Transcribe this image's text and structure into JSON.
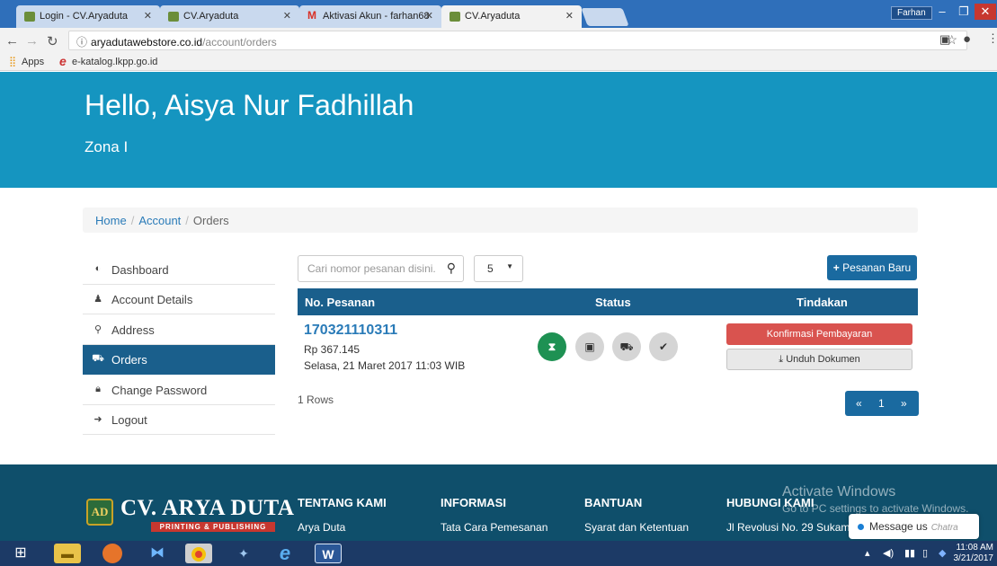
{
  "browser": {
    "tabs": [
      {
        "title": "Login - CV.Aryaduta",
        "favicon": "aryaduta-icon"
      },
      {
        "title": "CV.Aryaduta",
        "favicon": "aryaduta-icon"
      },
      {
        "title": "Aktivasi Akun - farhan68",
        "favicon": "gmail-icon"
      },
      {
        "title": "CV.Aryaduta",
        "favicon": "aryaduta-icon"
      }
    ],
    "user_label": "Farhan",
    "url_host": "aryadutawebstore.co.id",
    "url_path": "/account/orders",
    "bookmarks": [
      "Apps",
      "e-katalog.lkpp.go.id"
    ]
  },
  "hero": {
    "greeting": "Hello, Aisya Nur Fadhillah",
    "zone": "Zona I"
  },
  "breadcrumb": [
    "Home",
    "Account",
    "Orders"
  ],
  "sidebar": {
    "items": [
      {
        "label": "Dashboard",
        "icon": "dashboard-icon"
      },
      {
        "label": "Account Details",
        "icon": "user-icon"
      },
      {
        "label": "Address",
        "icon": "map-marker-icon"
      },
      {
        "label": "Orders",
        "icon": "cart-icon"
      },
      {
        "label": "Change Password",
        "icon": "lock-icon"
      },
      {
        "label": "Logout",
        "icon": "logout-icon"
      }
    ],
    "active": "Orders"
  },
  "orders": {
    "search_placeholder": "Cari nomor pesanan disini.",
    "per_page": "5",
    "new_button": "Pesanan Baru",
    "columns": [
      "No. Pesanan",
      "Status",
      "Tindakan"
    ],
    "rows": [
      {
        "order_no": "170321110311",
        "amount": "Rp 367.145",
        "date": "Selasa, 21 Maret 2017 11:03 WIB",
        "statuses": [
          "hourglass-icon",
          "money-icon",
          "truck-icon",
          "check-icon"
        ],
        "actions": [
          "Konfirmasi Pembayaran",
          "Unduh Dokumen"
        ]
      }
    ],
    "row_count": "1 Rows",
    "pagination": {
      "prev": "«",
      "page": "1",
      "next": "»"
    }
  },
  "footer": {
    "logo_title": "CV. ARYA DUTA",
    "logo_subtitle": "PRINTING & PUBLISHING",
    "logo_mark": "AD",
    "columns": [
      {
        "heading": "TENTANG KAMI",
        "link": "Arya Duta"
      },
      {
        "heading": "INFORMASI",
        "link": "Tata Cara Pemesanan"
      },
      {
        "heading": "BANTUAN",
        "link": "Syarat dan Ketentuan"
      },
      {
        "heading": "HUBUNGI KAMI",
        "link": "Jl Revolusi No. 29 Sukamaj"
      }
    ],
    "watermark_title": "Activate Windows",
    "watermark_text": "Go to PC settings to activate Windows."
  },
  "chat": {
    "label": "Message us",
    "brand": "Chatra"
  },
  "taskbar": {
    "time": "11:08 AM",
    "date": "3/21/2017"
  },
  "colors": {
    "hero": "#1595c0",
    "nav_active": "#1a5f8c",
    "footer": "#0f4f6b",
    "danger": "#d9534f",
    "success": "#1e9153"
  }
}
